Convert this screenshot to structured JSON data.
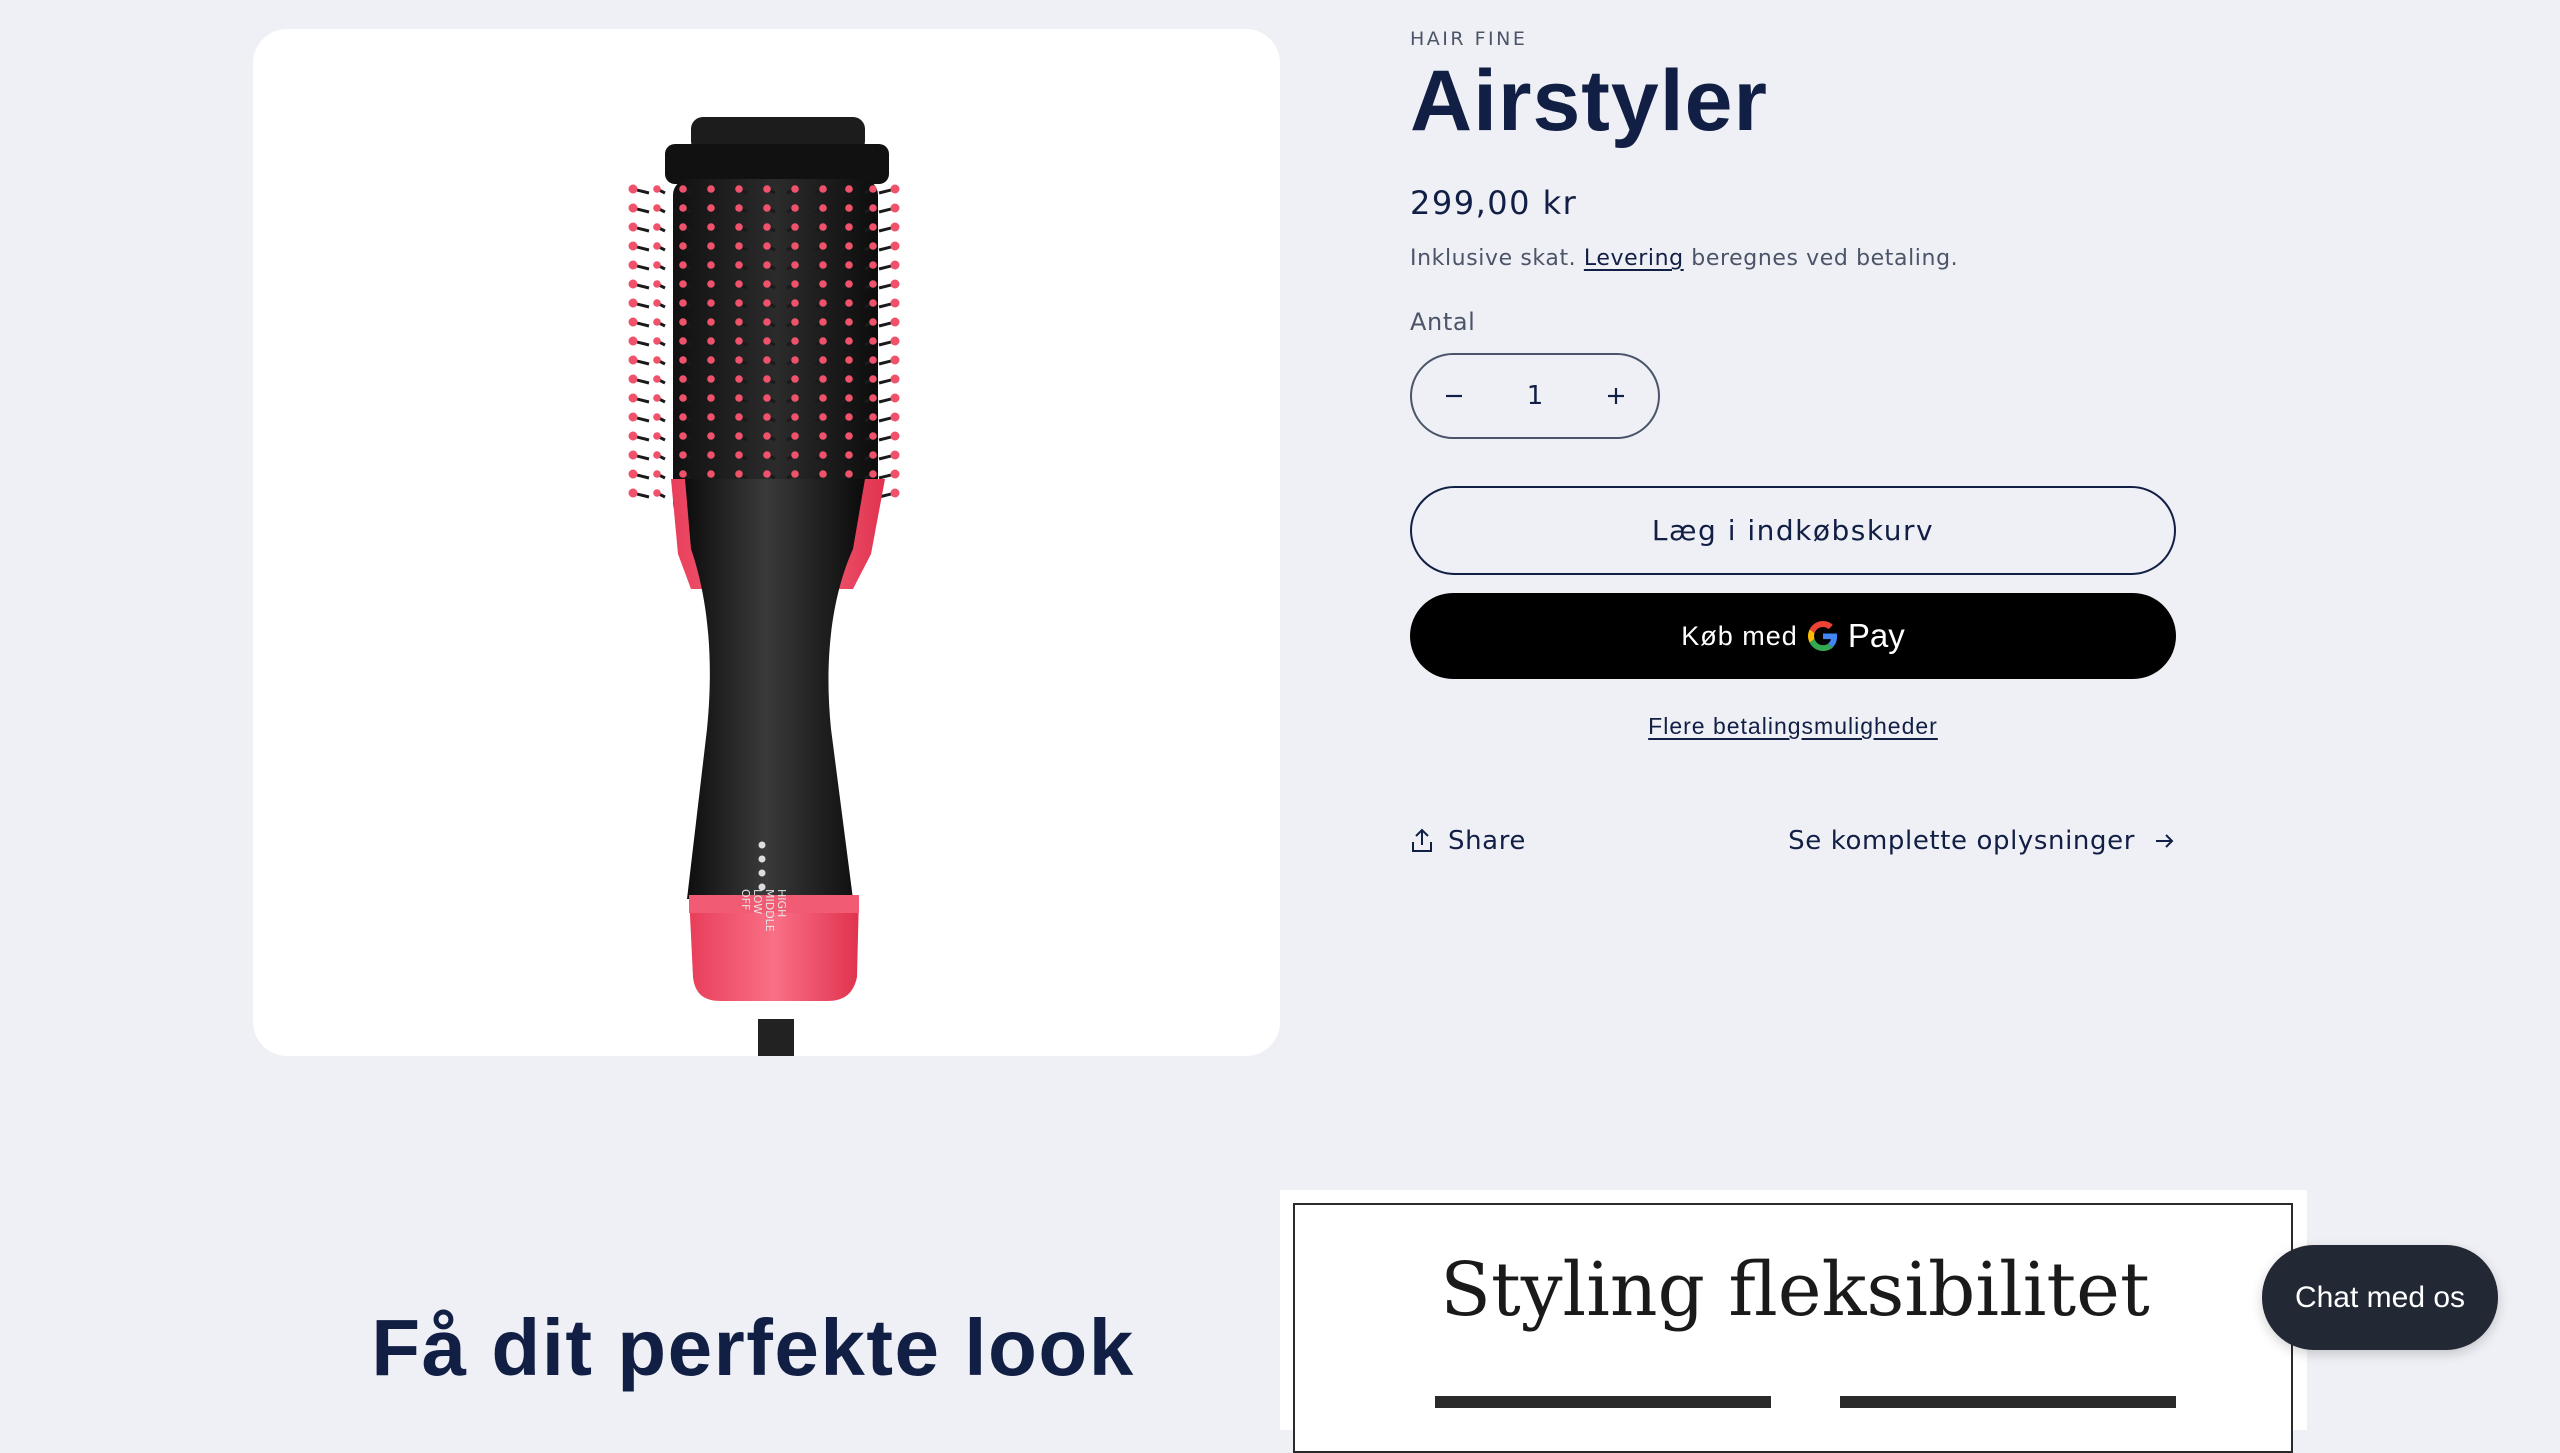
{
  "product": {
    "vendor": "HAIR FINE",
    "title": "Airstyler",
    "price": "299,00 kr",
    "tax_prefix": "Inklusive skat.",
    "tax_link": "Levering",
    "tax_suffix": "beregnes ved betaling.",
    "image_labels": [
      "HIGH",
      "MIDDLE",
      "LOW",
      "OFF"
    ]
  },
  "quantity": {
    "label": "Antal",
    "value": "1"
  },
  "buttons": {
    "add_to_cart": "Læg i indkøbskurv",
    "gpay_prefix": "Køb med",
    "gpay_pay": "Pay",
    "more_payment": "Flere betalingsmuligheder",
    "share": "Share",
    "full_details": "Se komplette oplysninger"
  },
  "section": {
    "headline": "Få dit perfekte look",
    "feature_title": "Styling fleksibilitet"
  },
  "chat": {
    "label": "Chat med os"
  },
  "colors": {
    "background": "#eff0f5",
    "text": "#121f45",
    "accent_pink": "#f0526b",
    "gpay_button": "#000000",
    "chat_button": "#222935"
  }
}
